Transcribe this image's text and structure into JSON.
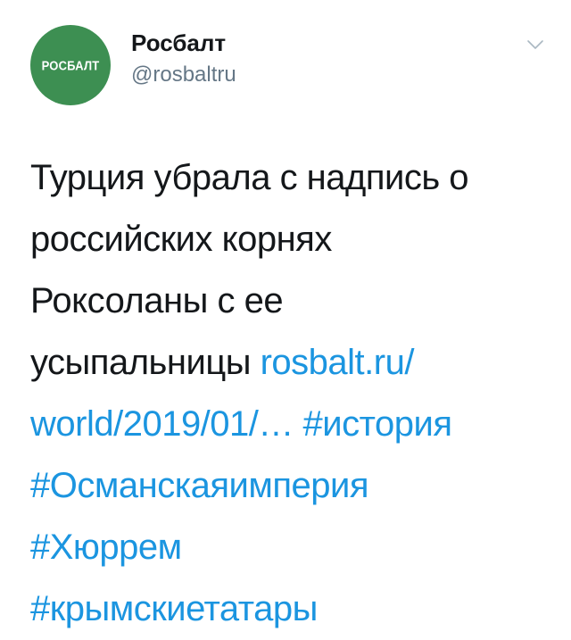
{
  "account": {
    "avatar_text": "РОСБАЛТ",
    "display_name": "Росбалт",
    "handle": "@rosbaltru"
  },
  "tweet": {
    "text_line_1": "Турция убрала с надпись о",
    "text_line_2": "российских корнях",
    "text_line_3": "Роксоланы с ее",
    "text_line_4": "усыпальницы",
    "link_part_1": "rosbalt.ru/",
    "link_part_2": "world/2019/01/…",
    "hashtags": [
      "#история",
      "#Османскаяимперия",
      "#Хюррем",
      "#крымскиетатары"
    ]
  },
  "icons": {
    "menu": "chevron-down-icon"
  },
  "colors": {
    "avatar_bg": "#3d8f52",
    "link": "#1b95e0",
    "handle": "#657786",
    "text": "#14171a"
  }
}
